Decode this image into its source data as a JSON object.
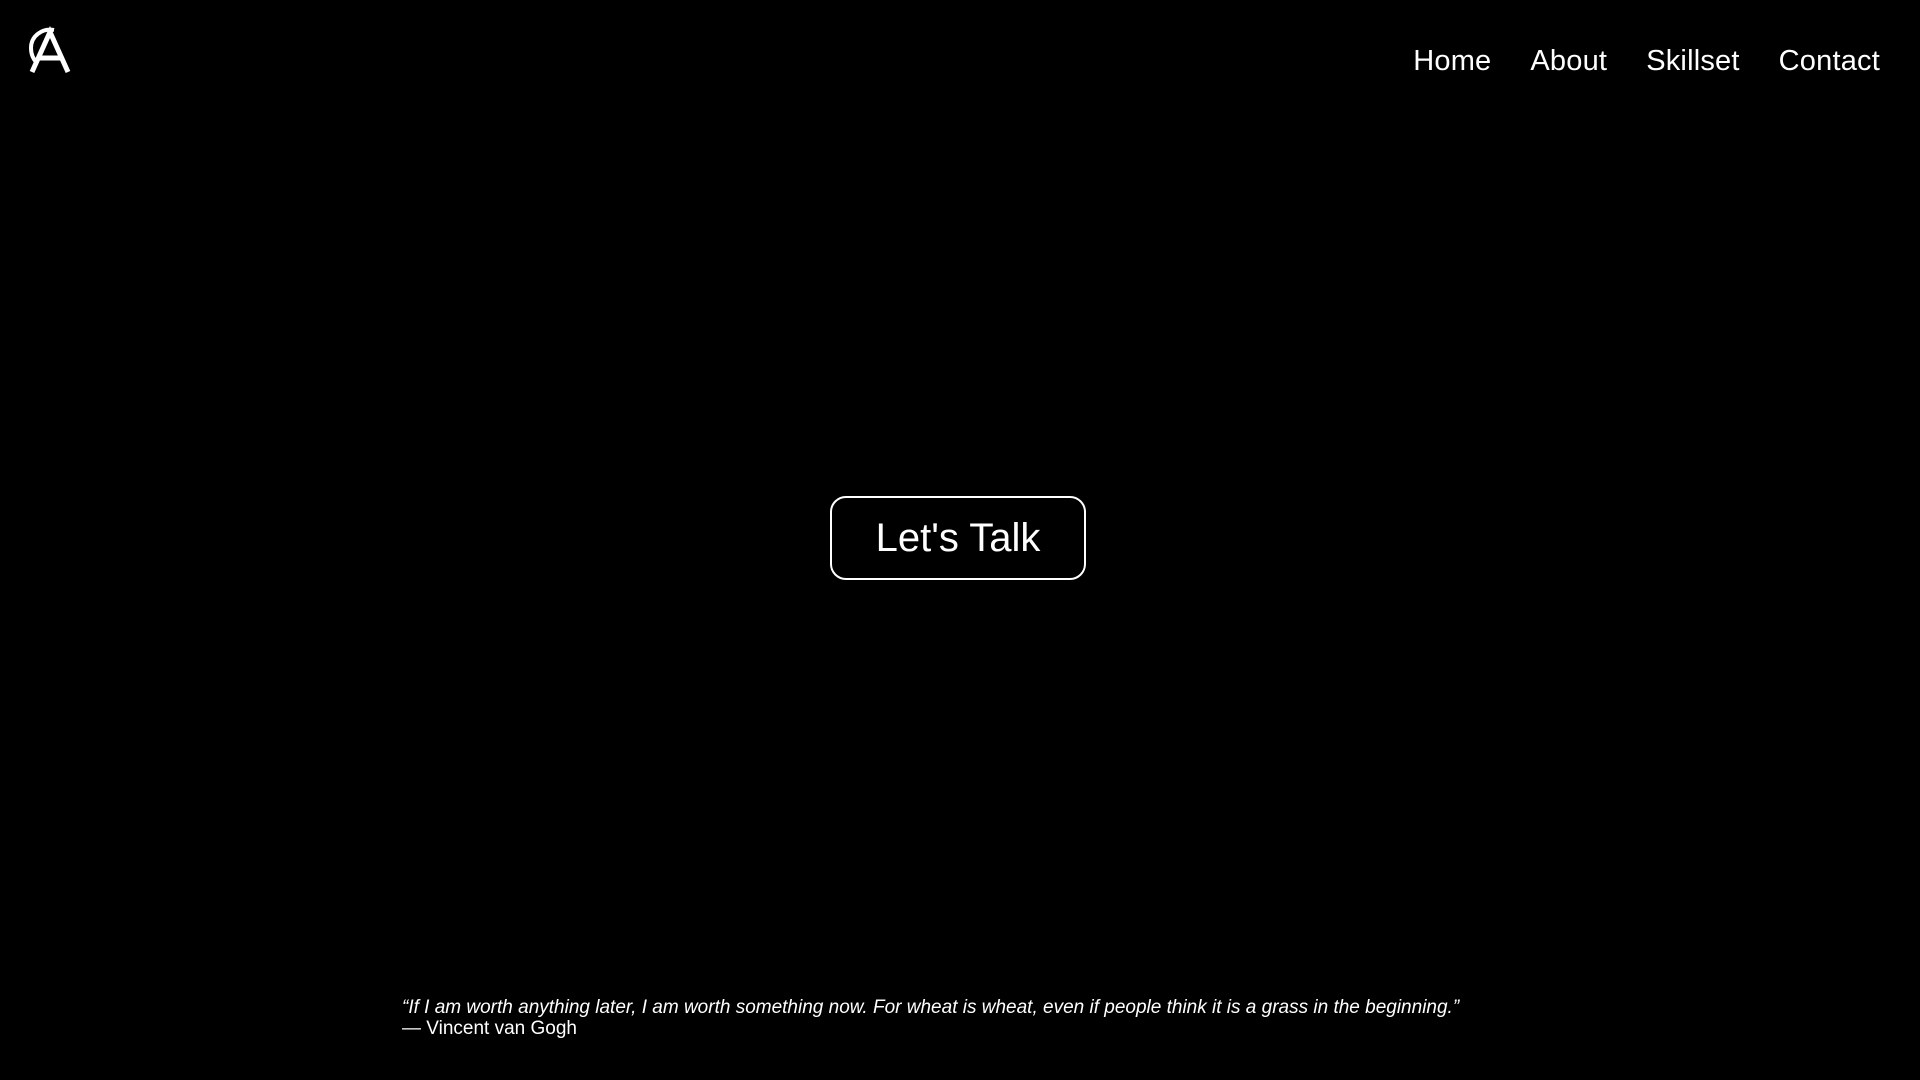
{
  "header": {
    "logo_icon": "a-monogram-logo-icon",
    "nav": [
      {
        "label": "Home"
      },
      {
        "label": "About"
      },
      {
        "label": "Skillset"
      },
      {
        "label": "Contact"
      }
    ]
  },
  "main": {
    "cta_label": "Let's Talk"
  },
  "footer": {
    "quote_text": "“If I am worth anything later, I am worth something now. For wheat is wheat, even if people think it is a grass in the beginning.”",
    "quote_author": "— Vincent van Gogh"
  },
  "colors": {
    "background": "#000000",
    "foreground": "#ffffff"
  }
}
